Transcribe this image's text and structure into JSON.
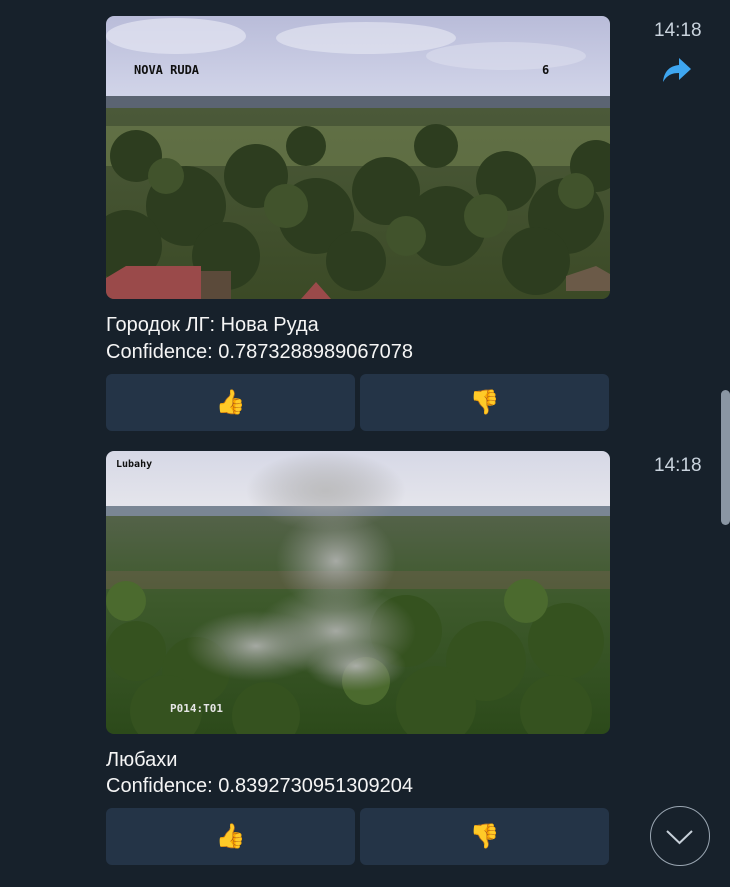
{
  "messages": [
    {
      "time": "14:18",
      "camera_overlay_name": "NOVA RUDA",
      "camera_overlay_number": "6",
      "caption_location": "Городок ЛГ: Нова Руда",
      "caption_confidence": "Confidence: 0.7873288989067078",
      "thumbs_up": "👍",
      "thumbs_down": "👎"
    },
    {
      "time": "14:18",
      "camera_overlay_name": "Lubahy",
      "camera_overlay_ptz": "P014:T01",
      "caption_location": "Любахи",
      "caption_confidence": "Confidence: 0.8392730951309204",
      "thumbs_up": "👍",
      "thumbs_down": "👎"
    }
  ],
  "icons": {
    "forward": "forward-arrow-icon",
    "scroll_down": "chevron-down-icon"
  },
  "colors": {
    "background": "#17212b",
    "button": "#243447",
    "accent": "#3ea6f0"
  }
}
